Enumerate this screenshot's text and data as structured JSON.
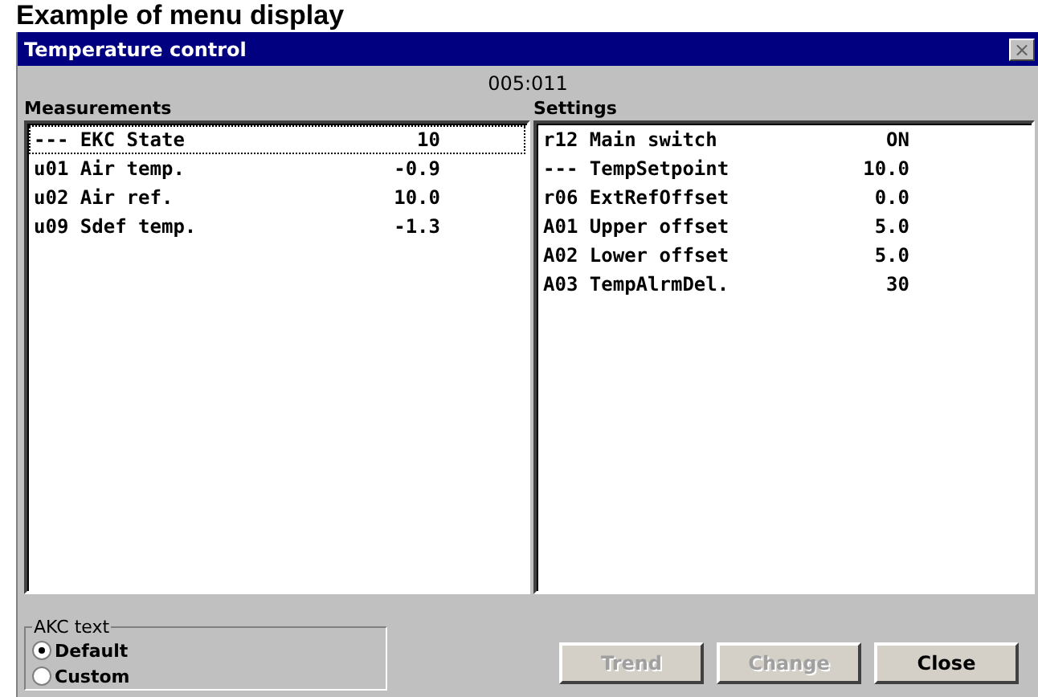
{
  "page_heading": "Example of menu display",
  "window": {
    "title": "Temperature control",
    "close_glyph": "×"
  },
  "address": "005:011",
  "measurements": {
    "heading": "Measurements",
    "rows": [
      {
        "code": "---",
        "name": "EKC State",
        "value": "10",
        "selected": true
      },
      {
        "code": "u01",
        "name": "Air temp.",
        "value": "-0.9",
        "selected": false
      },
      {
        "code": "u02",
        "name": "Air ref.",
        "value": "10.0",
        "selected": false
      },
      {
        "code": "u09",
        "name": "Sdef temp.",
        "value": "-1.3",
        "selected": false
      }
    ]
  },
  "settings": {
    "heading": "Settings",
    "rows": [
      {
        "code": "r12",
        "name": "Main switch",
        "value": "ON",
        "selected": false
      },
      {
        "code": "---",
        "name": "TempSetpoint",
        "value": "10.0",
        "selected": false
      },
      {
        "code": "r06",
        "name": "ExtRefOffset",
        "value": "0.0",
        "selected": false
      },
      {
        "code": "A01",
        "name": "Upper offset",
        "value": "5.0",
        "selected": false
      },
      {
        "code": "A02",
        "name": "Lower offset",
        "value": "5.0",
        "selected": false
      },
      {
        "code": "A03",
        "name": "TempAlrmDel.",
        "value": "30",
        "selected": false
      }
    ]
  },
  "akc_text": {
    "legend": "AKC text",
    "options": [
      {
        "label": "Default",
        "selected": true
      },
      {
        "label": "Custom",
        "selected": false
      }
    ]
  },
  "buttons": [
    {
      "label": "Trend",
      "disabled": true
    },
    {
      "label": "Change",
      "disabled": true
    },
    {
      "label": "Close",
      "disabled": false
    }
  ]
}
